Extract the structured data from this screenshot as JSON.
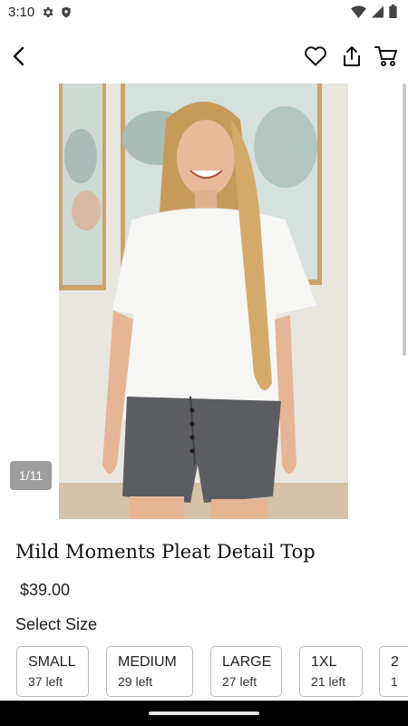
{
  "status_bar": {
    "time": "3:10",
    "left_icons": [
      "gear-icon",
      "shield-icon"
    ],
    "right_icons": [
      "wifi-icon",
      "signal-icon",
      "battery-icon"
    ]
  },
  "app_bar": {
    "icons": [
      "back-arrow-icon",
      "heart-icon",
      "share-icon",
      "cart-icon"
    ]
  },
  "product": {
    "image_counter": "1/11",
    "title": "Mild Moments Pleat Detail Top",
    "price": "$39.00"
  },
  "sizes": {
    "heading": "Select Size",
    "options": [
      {
        "name": "SMALL",
        "stock": "37 left"
      },
      {
        "name": "MEDIUM",
        "stock": "29 left"
      },
      {
        "name": "LARGE",
        "stock": "27 left"
      },
      {
        "name": "1XL",
        "stock": "21 left"
      },
      {
        "name": "2",
        "stock": "1"
      }
    ]
  },
  "colors": {
    "border": "#bdbdbd",
    "counter_bg": "#9e9e9e"
  }
}
